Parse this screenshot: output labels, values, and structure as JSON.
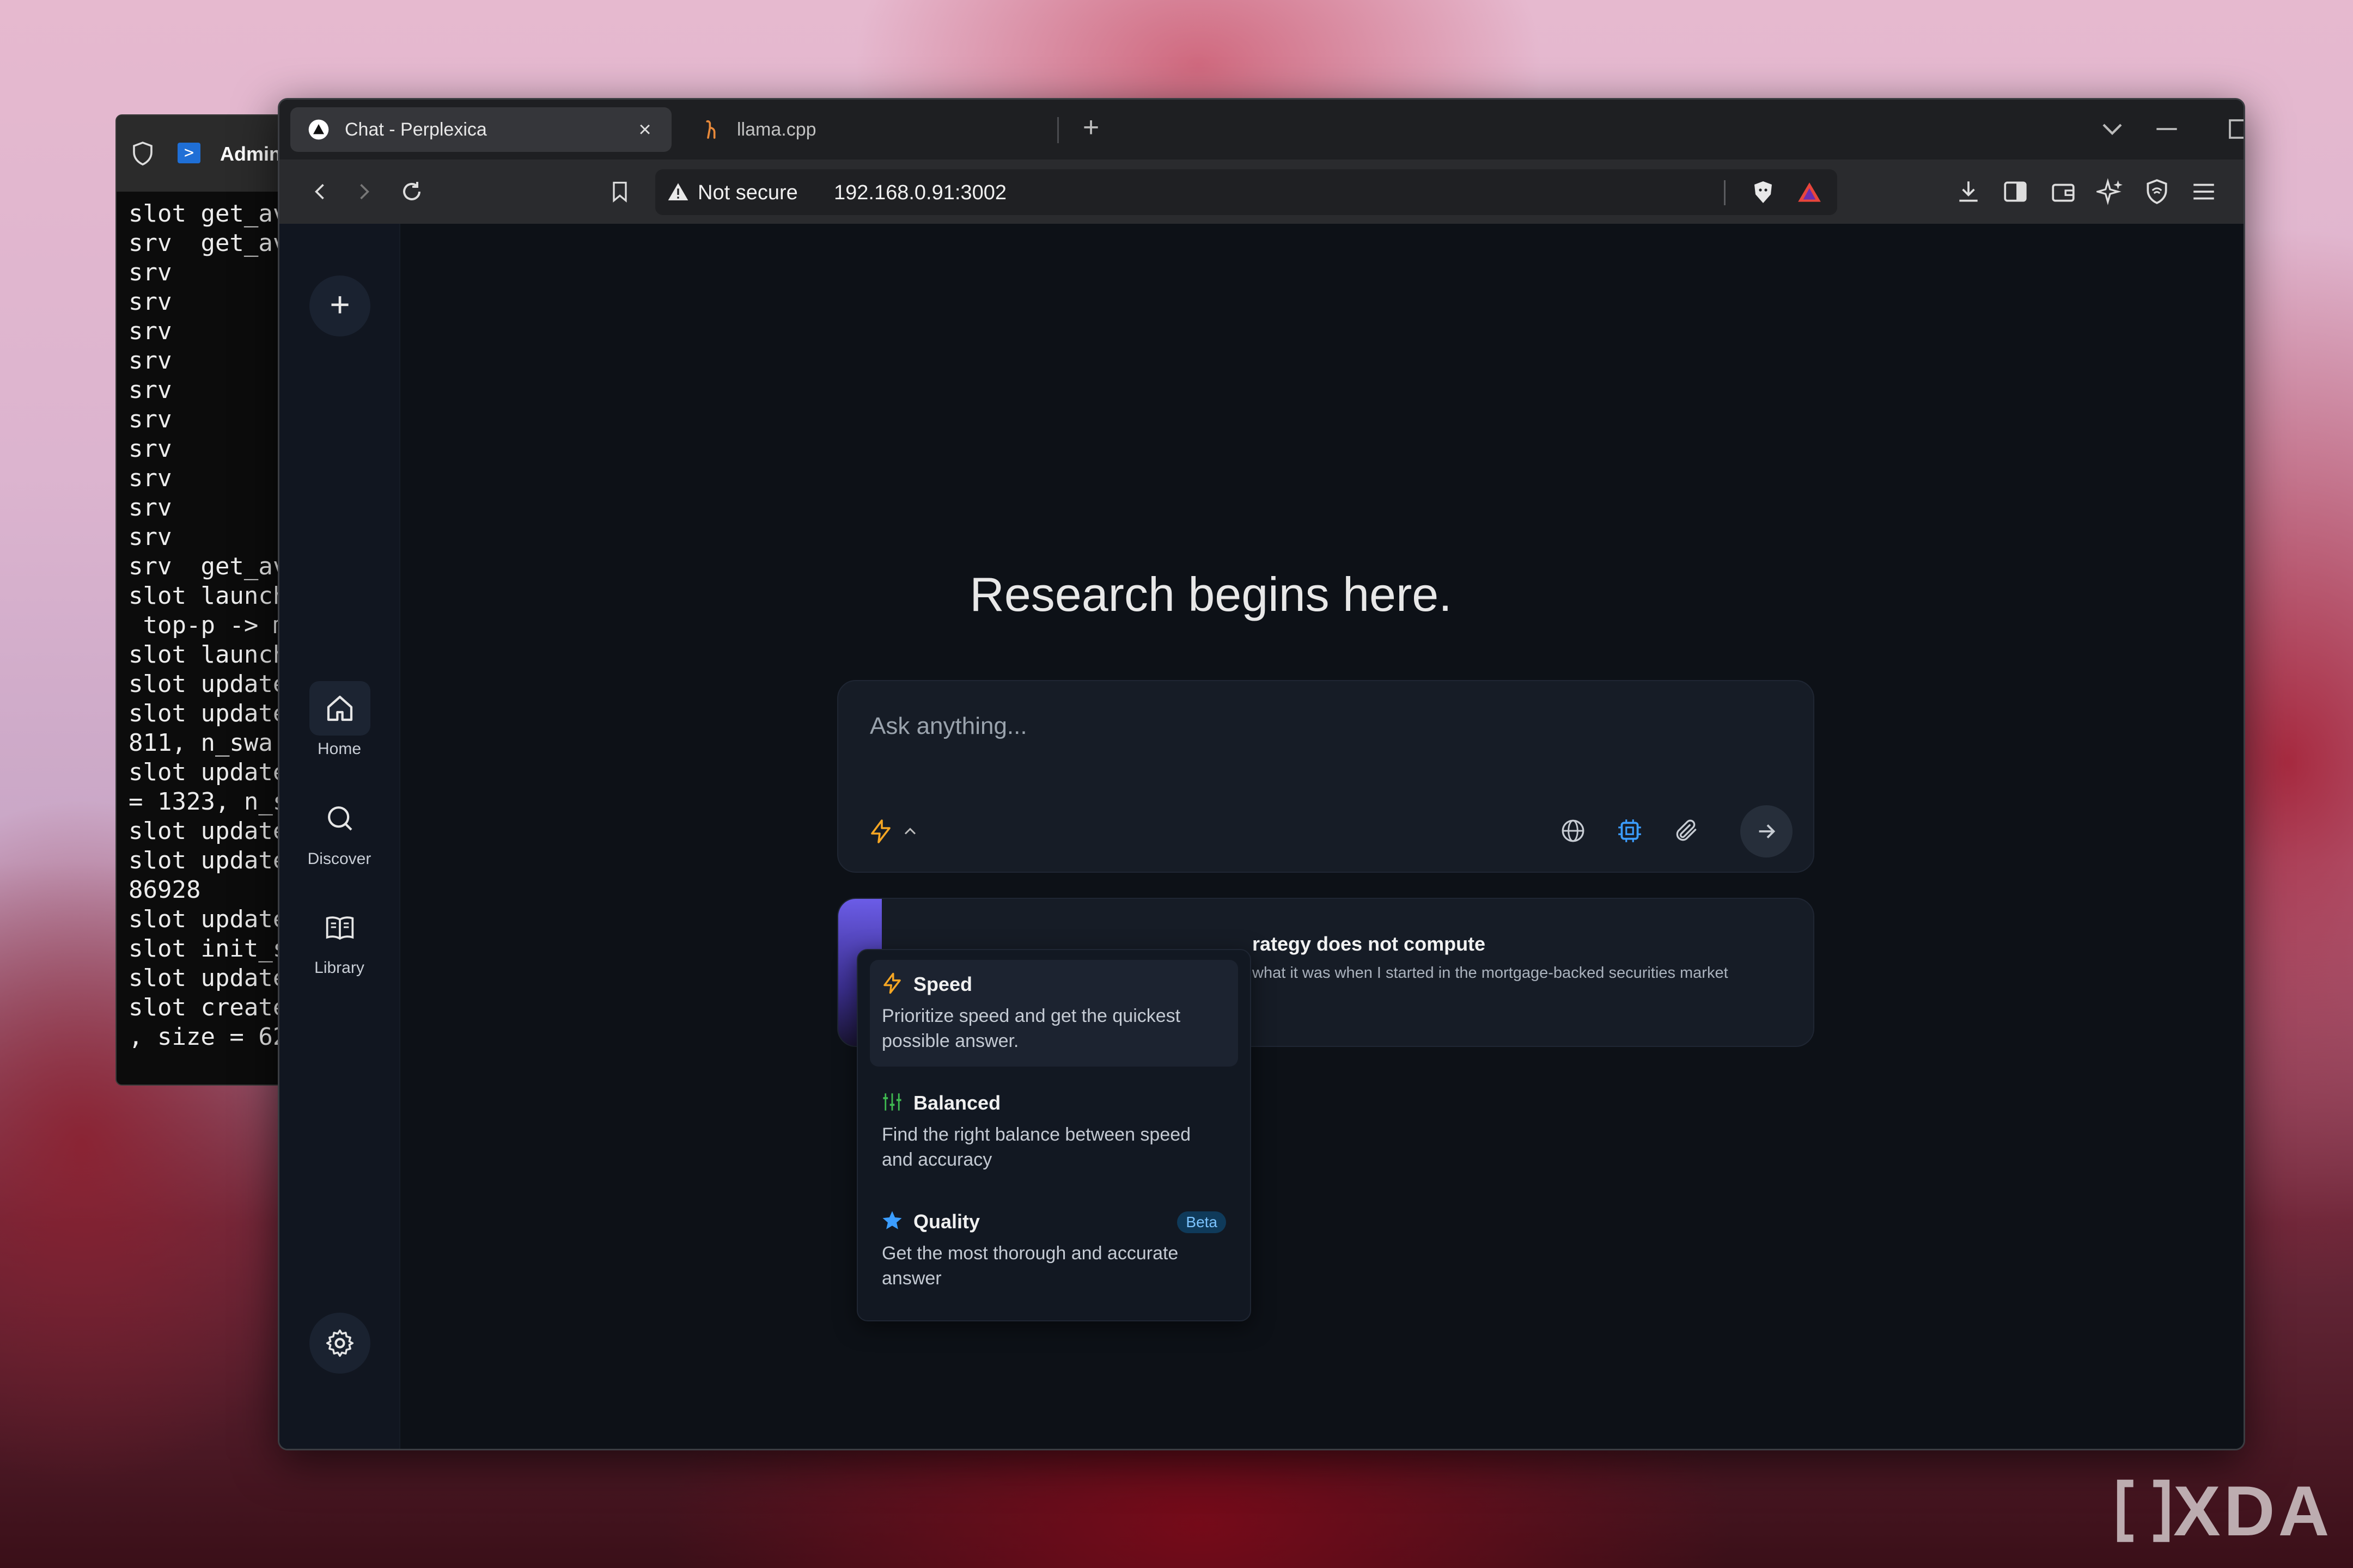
{
  "terminal": {
    "tab_title": "Admin",
    "lines": [
      "slot get_av",
      "srv  get_av",
      "srv",
      "srv",
      "srv",
      "srv",
      "srv",
      "srv",
      "srv",
      "srv",
      "srv",
      "srv",
      "srv  get_av",
      "slot launch",
      " top-p -> m",
      "slot launch",
      "slot update",
      "slot update",
      "811, n_swa",
      "slot update",
      "= 1323, n_s",
      "slot update",
      "slot update",
      "86928",
      "slot update",
      "slot init_s",
      "slot update",
      "slot create",
      ", size = 62"
    ]
  },
  "browser": {
    "tabs": [
      {
        "label": "Chat - Perplexica",
        "active": true
      },
      {
        "label": "llama.cpp",
        "active": false
      }
    ],
    "url_security": "Not secure",
    "url": "192.168.0.91:3002"
  },
  "sidebar": {
    "items": [
      {
        "label": "Home",
        "icon": "home-icon"
      },
      {
        "label": "Discover",
        "icon": "search-icon"
      },
      {
        "label": "Library",
        "icon": "book-icon"
      }
    ]
  },
  "main": {
    "hero_title": "Research begins here.",
    "search_placeholder": "Ask anything...",
    "discover_card": {
      "title": "rategy does not compute",
      "description": "what it was when I started in the mortgage-backed securities market"
    }
  },
  "mode_menu": {
    "options": [
      {
        "name": "Speed",
        "description": "Prioritize speed and get the quickest possible answer.",
        "icon": "lightning-icon",
        "icon_color": "#f5a623"
      },
      {
        "name": "Balanced",
        "description": "Find the right balance between speed and accuracy",
        "icon": "sliders-icon",
        "icon_color": "#3fb950"
      },
      {
        "name": "Quality",
        "description": "Get the most thorough and accurate answer",
        "icon": "star-icon",
        "icon_color": "#3b9dff",
        "badge": "Beta"
      }
    ]
  },
  "watermark": "XDA",
  "colors": {
    "accent": "#f5a623",
    "active_icon": "#3b9dff",
    "app_bg": "#0d1117"
  }
}
